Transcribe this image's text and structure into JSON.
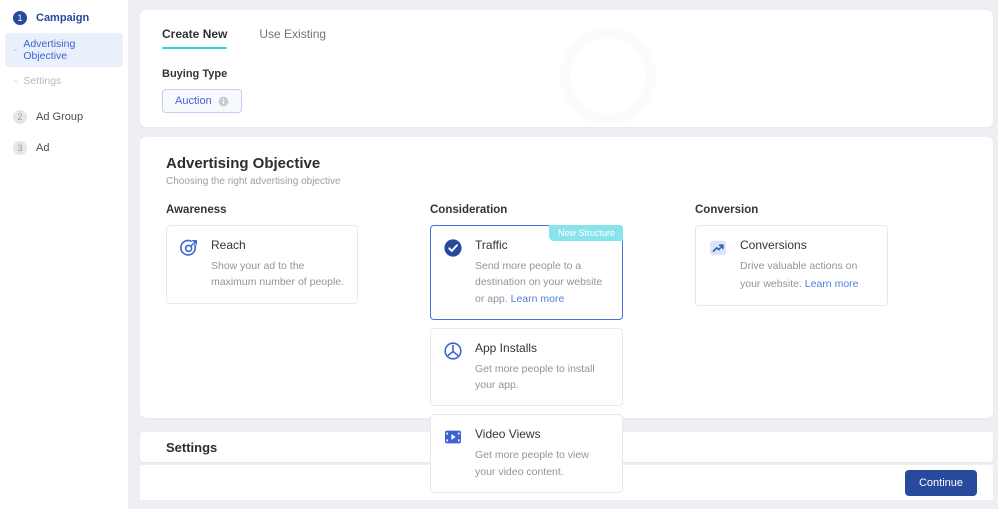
{
  "colors": {
    "accent_blue": "#3e63d2",
    "navy": "#274a9c",
    "tab_underline_cyan": "#2bd6d6",
    "badge_cyan": "#89e3ec",
    "link_blue": "#4e7fe1",
    "selected_border": "#4a6fdc",
    "sidebar_highlight": "#e9effb"
  },
  "sidebar": {
    "steps": [
      {
        "number": "1",
        "label": "Campaign",
        "state": "active"
      },
      {
        "number": "2",
        "label": "Ad Group",
        "state": "default"
      },
      {
        "number": "3",
        "label": "Ad",
        "state": "default"
      }
    ],
    "campaign_sub_items": [
      {
        "label": "Advertising Objective",
        "state": "selected"
      },
      {
        "label": "Settings",
        "state": "default"
      }
    ]
  },
  "top_card": {
    "tabs": [
      {
        "label": "Create New",
        "active": true
      },
      {
        "label": "Use Existing",
        "active": false
      }
    ],
    "buying_type": {
      "label": "Buying Type",
      "value": "Auction"
    }
  },
  "objective_section": {
    "title": "Advertising Objective",
    "subtitle": "Choosing the right advertising objective",
    "columns": [
      {
        "header": "Awareness",
        "cards": [
          {
            "icon": "reach-target-icon",
            "title": "Reach",
            "description": "Show your ad to the maximum number of people."
          }
        ]
      },
      {
        "header": "Consideration",
        "cards": [
          {
            "icon": "check-circle-icon",
            "title": "Traffic",
            "description": "Send more people to a destination on your website or app.",
            "link": "Learn more",
            "badge": "New Structure",
            "selected": true
          },
          {
            "icon": "app-install-icon",
            "title": "App Installs",
            "description": "Get more people to install your app."
          },
          {
            "icon": "video-views-icon",
            "title": "Video Views",
            "description": "Get more people to view your video content."
          }
        ]
      },
      {
        "header": "Conversion",
        "cards": [
          {
            "icon": "conversions-chart-icon",
            "title": "Conversions",
            "description": "Drive valuable actions on your website.",
            "link": "Learn more"
          }
        ]
      }
    ]
  },
  "settings_section": {
    "title": "Settings"
  },
  "footer": {
    "continue_label": "Continue"
  }
}
